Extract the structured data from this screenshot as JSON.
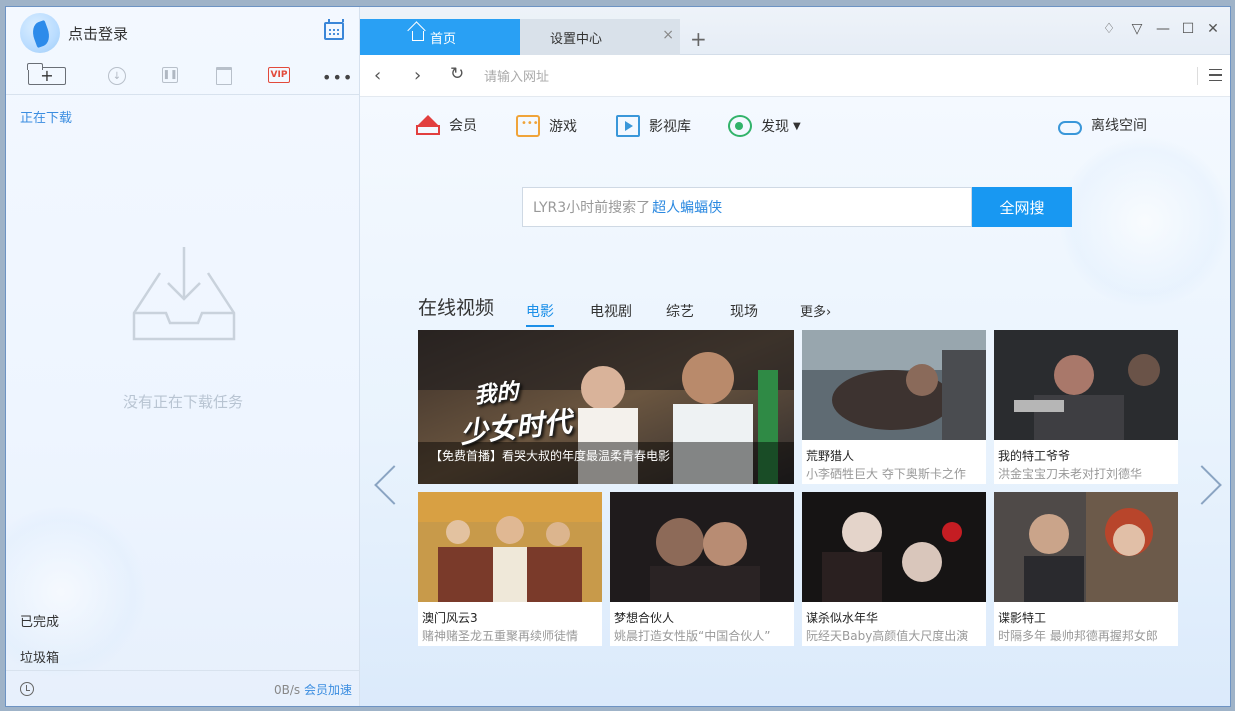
{
  "left": {
    "login_text": "点击登录",
    "section_downloading": "正在下载",
    "empty_text": "没有正在下载任务",
    "toolbar": {
      "new_task": "+",
      "vip": "VIP",
      "more": "•••"
    },
    "completed": "已完成",
    "trash": "垃圾箱",
    "speed": "0B/s",
    "speedup": "会员加速"
  },
  "tabs": [
    {
      "label": "首页",
      "active": true
    },
    {
      "label": "设置中心",
      "active": false
    }
  ],
  "tab_close": "×",
  "tab_add": "+",
  "window_buttons": {
    "skin": "♢",
    "menu": "▽",
    "minimize": "—",
    "maximize": "☐",
    "close": "✕"
  },
  "address": {
    "placeholder": "请输入网址"
  },
  "quicknav": [
    {
      "label": "会员",
      "icon": "crown-icon"
    },
    {
      "label": "游戏",
      "icon": "game-icon"
    },
    {
      "label": "影视库",
      "icon": "film-library-icon"
    },
    {
      "label": "发现",
      "icon": "discover-icon"
    },
    {
      "label": "离线空间",
      "icon": "cloud-icon"
    }
  ],
  "search": {
    "hint_prefix": "LYR3小时前搜索了",
    "hint_keyword": "超人蝙蝠侠",
    "button": "全网搜"
  },
  "video": {
    "title": "在线视频",
    "categories": [
      "电影",
      "电视剧",
      "综艺",
      "现场",
      "更多›"
    ],
    "featured": {
      "poster_text_1": "我的",
      "poster_text_2": "少女时代",
      "caption": "【免费首播】看哭大叔的年度最温柔青春电影"
    },
    "cards": [
      {
        "title": "荒野猎人",
        "subtitle": "小李硒牲巨大 夺下奥斯卡之作"
      },
      {
        "title": "我的特工爷爷",
        "subtitle": "洪金宝宝刀未老对打刘德华"
      },
      {
        "title": "澳门风云3",
        "subtitle": "赌神赌圣龙五重聚再续师徒情"
      },
      {
        "title": "梦想合伙人",
        "subtitle": "姚晨打造女性版“中国合伙人”"
      },
      {
        "title": "谋杀似水年华",
        "subtitle": "阮经天Baby高颜值大尺度出演"
      },
      {
        "title": "谍影特工",
        "subtitle": "时隔多年 最帅邦德再握邦女郎"
      }
    ]
  },
  "colors": {
    "accent": "#29a0f4",
    "vip": "#e24a3b",
    "link": "#3b8de0"
  }
}
